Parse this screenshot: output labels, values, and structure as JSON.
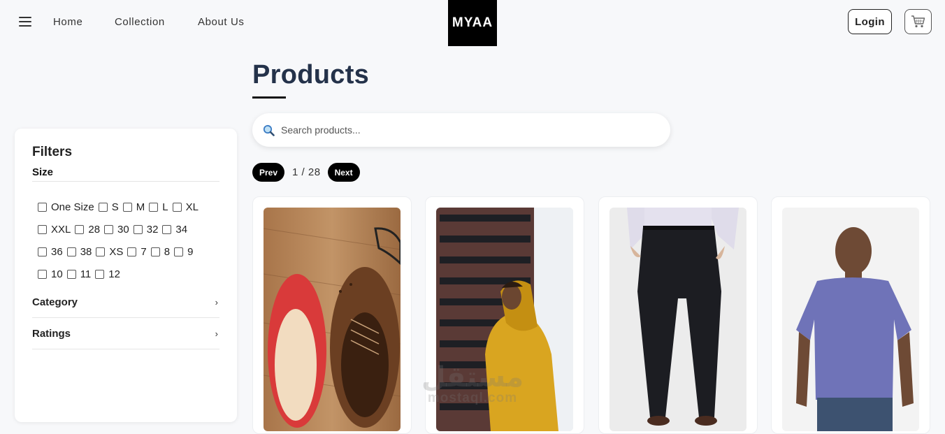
{
  "header": {
    "nav": [
      "Home",
      "Collection",
      "About Us"
    ],
    "logo": "MYAA",
    "login_label": "Login"
  },
  "filters": {
    "title": "Filters",
    "size_title": "Size",
    "sizes": [
      [
        "One Size",
        "S",
        "M",
        "L",
        "XL"
      ],
      [
        "XXL",
        "28",
        "30",
        "32",
        "34"
      ],
      [
        "36",
        "38",
        "XS",
        "7",
        "8",
        "9"
      ],
      [
        "10",
        "11",
        "12"
      ]
    ],
    "sections": [
      "Category",
      "Ratings"
    ]
  },
  "main": {
    "title": "Products",
    "search_placeholder": "Search products...",
    "pager": {
      "prev": "Prev",
      "next": "Next",
      "page_info": "1 / 28"
    }
  },
  "products": [
    {
      "image": "red flats and brown brogue shoes on wooden floor"
    },
    {
      "image": "man in yellow hoodie in front of building"
    },
    {
      "image": "man wearing black trousers"
    },
    {
      "image": "man in blue t-shirt"
    }
  ],
  "watermark": {
    "line1": "مستقل",
    "line2": "mostaql.com"
  }
}
